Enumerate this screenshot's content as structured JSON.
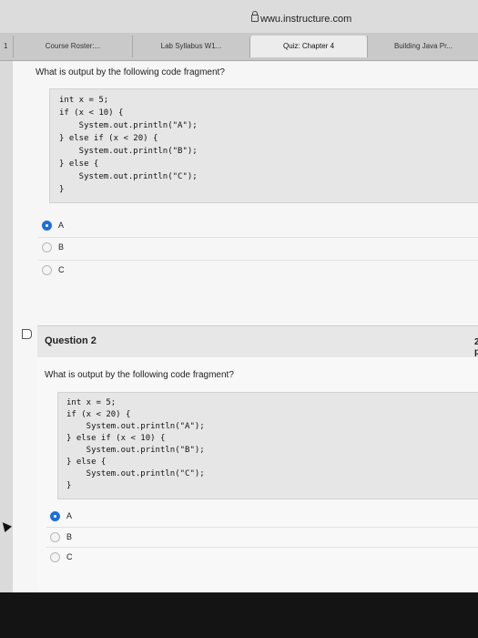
{
  "browser": {
    "url": "wwu.instructure.com",
    "tab_edge": "1",
    "tabs": [
      {
        "label": "Course Roster:..."
      },
      {
        "label": "Lab Syllabus W1..."
      },
      {
        "label": "Quiz: Chapter 4"
      },
      {
        "label": "Building Java Pr..."
      }
    ],
    "active_tab": 2
  },
  "question1": {
    "prompt": "What is output by the following code fragment?",
    "code": [
      "int x = 5;",
      "if (x < 10) {",
      "    System.out.println(\"A\");",
      "} else if (x < 20) {",
      "    System.out.println(\"B\");",
      "} else {",
      "    System.out.println(\"C\");",
      "}"
    ],
    "options": [
      {
        "label": "A",
        "selected": true
      },
      {
        "label": "B",
        "selected": false
      },
      {
        "label": "C",
        "selected": false
      }
    ]
  },
  "question2": {
    "title": "Question 2",
    "points": "2 p",
    "prompt": "What is output by the following code fragment?",
    "code": [
      "int x = 5;",
      "if (x < 20) {",
      "    System.out.println(\"A\");",
      "} else if (x < 10) {",
      "    System.out.println(\"B\");",
      "} else {",
      "    System.out.println(\"C\");",
      "}"
    ],
    "options": [
      {
        "label": "A",
        "selected": true
      },
      {
        "label": "B",
        "selected": false
      },
      {
        "label": "C",
        "selected": false
      }
    ]
  },
  "colors": {
    "selected_radio": "#1e6fd9",
    "page_background": "#f6f6f6",
    "code_background": "#e6e6e6"
  }
}
